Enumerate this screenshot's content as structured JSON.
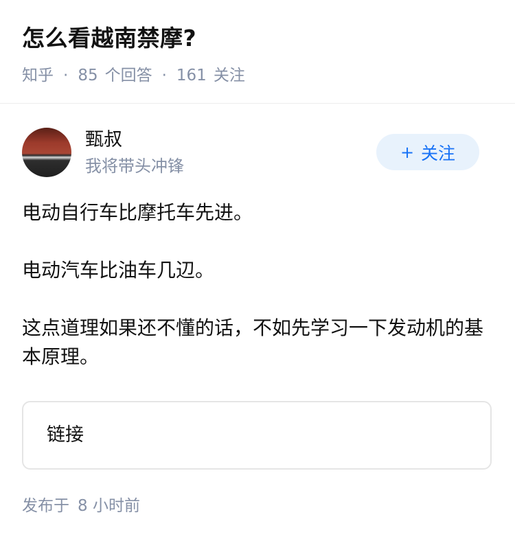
{
  "question": {
    "title": "怎么看越南禁摩?",
    "site": "知乎",
    "answers_count": "85",
    "answers_label": "个回答",
    "followers_count": "161",
    "followers_label": "关注"
  },
  "author": {
    "name": "甄叔",
    "bio": "我将带头冲锋",
    "follow_label": "关注"
  },
  "answer": {
    "paragraphs": [
      "电动自行车比摩托车先进。",
      "电动汽车比油车几辺。",
      "这点道理如果还不懂的话，不如先学习一下发动机的基本原理。"
    ],
    "link_card_label": "链接"
  },
  "footer": {
    "published_label": "发布于",
    "published_time": "8 小时前"
  }
}
